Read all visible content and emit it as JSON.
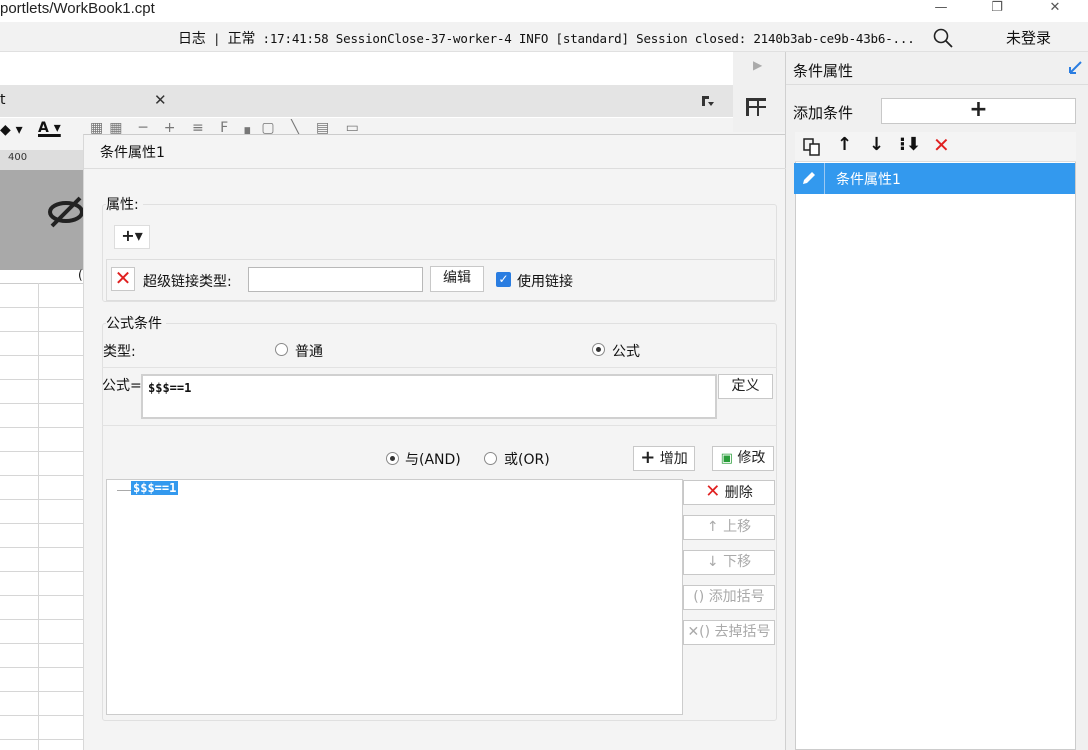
{
  "window": {
    "title": "portlets/WorkBook1.cpt",
    "minimize_icon": "minimize-icon",
    "restore_icon": "restore-icon",
    "close_icon": "close-icon"
  },
  "logbar": {
    "label": "日志",
    "status": "正常",
    "message": "17:41:58 SessionClose-37-worker-4 INFO [standard] Session closed: 2140b3ab-ce9b-43b6-...",
    "login": "未登录"
  },
  "sheet": {
    "tab_label": "t",
    "ruler_value": "400",
    "column_header_fragment": "("
  },
  "right_panel": {
    "title": "条件属性",
    "add_condition_label": "添加条件",
    "add_button": "+",
    "list_items": [
      "条件属性1"
    ]
  },
  "dialog": {
    "title": "条件属性1",
    "attribute_group_label": "属性:",
    "add_attribute_button": "+▾",
    "hyperlink_type_label": "超级链接类型:",
    "hyperlink_type_value": "",
    "edit_button": "编辑",
    "use_link_label": "使用链接",
    "use_link_checked": true,
    "formula_group_label": "公式条件",
    "type_label": "类型:",
    "type_options": [
      "普通",
      "公式"
    ],
    "type_selected": "公式",
    "formula_label": "公式=",
    "formula_value": "$$$==1",
    "define_button": "定义",
    "and_label": "与(AND)",
    "or_label": "或(OR)",
    "logic_selected": "与(AND)",
    "add_button": "增加",
    "modify_button": "修改",
    "condition_list": [
      "$$$==1"
    ],
    "delete_button": "删除",
    "move_up_button": "上移",
    "move_down_button": "下移",
    "add_bracket_button": "添加括号",
    "remove_bracket_button": "去掉括号"
  },
  "colors": {
    "accent": "#3399ee",
    "danger": "#e02020",
    "checkbox": "#2a7de1"
  }
}
